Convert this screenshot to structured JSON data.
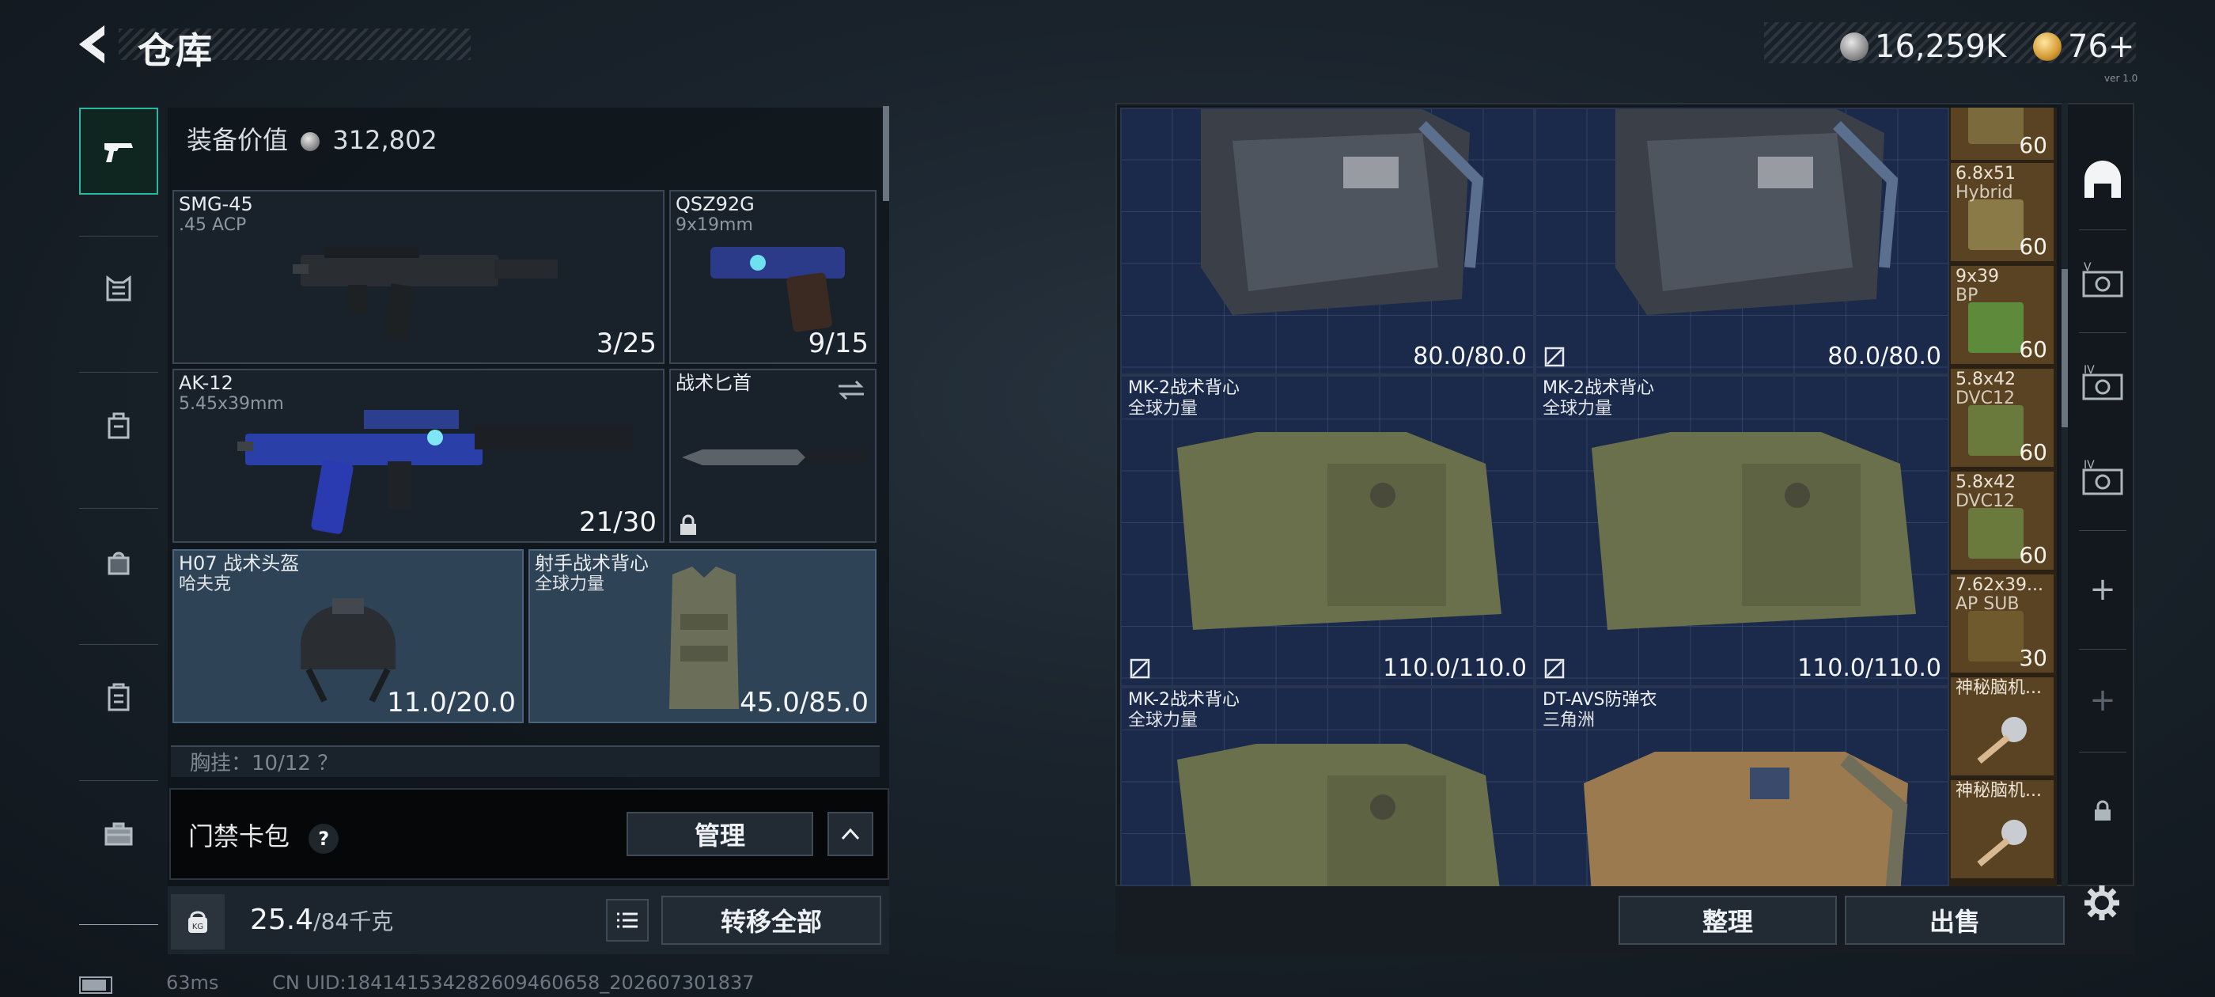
{
  "header": {
    "title": "仓库",
    "currency": [
      {
        "icon": "silver-coin-icon",
        "value": "16,259K"
      },
      {
        "icon": "gold-coin-icon",
        "value": "76+"
      }
    ],
    "tiny_text": "ver 1.0"
  },
  "left_rail": [
    "pistol-icon",
    "armor-rig-icon",
    "backpack-icon",
    "bag-icon",
    "case-icon",
    "toolbox-icon"
  ],
  "loadout": {
    "value_label": "装备价值",
    "value": "312,802",
    "slots": [
      {
        "name": "SMG-45",
        "sub": ".45 ACP",
        "count": "3/25"
      },
      {
        "name": "QSZ92G",
        "sub": "9x19mm",
        "count": "9/15"
      },
      {
        "name": "AK-12",
        "sub": "5.45x39mm",
        "count": "21/30"
      },
      {
        "name": "战术匕首",
        "sub": "",
        "count": ""
      },
      {
        "name": "H07 战术头盔",
        "sub": "哈夫克",
        "count": "11.0/20.0"
      },
      {
        "name": "射手战术背心",
        "sub": "全球力量",
        "count": "45.0/85.0"
      }
    ],
    "chest_row": "胸挂：10/12 ？",
    "keycard_label": "门禁卡包",
    "help": "?",
    "manage_button": "管理",
    "weight": "25.4",
    "weight_max": "/84千克",
    "transfer_button": "转移全部",
    "kg_label": "KG"
  },
  "status": {
    "ping": "63ms",
    "uid": "CN UID:1841415342826094606​58_202607301837"
  },
  "inventory": {
    "items": [
      {
        "name": "",
        "sub": "",
        "durability": ""
      },
      {
        "name": "",
        "sub": "",
        "durability": "80.0/80.0"
      },
      {
        "name": "",
        "sub": "",
        "durability": "80.0/80.0"
      },
      {
        "name": "MK-2战术背心",
        "sub": "全球力量",
        "durability": "110.0/110.0"
      },
      {
        "name": "MK-2战术背心",
        "sub": "全球力量",
        "durability": "110.0/110.0"
      },
      {
        "name": "MK-2战术背心",
        "sub": "全球力量",
        "durability": ""
      },
      {
        "name": "DT-AVS防弹衣",
        "sub": "三角洲",
        "durability": ""
      }
    ],
    "ammo": [
      {
        "name": "",
        "sub": "",
        "count": "60"
      },
      {
        "name": "6.8x51",
        "sub": "Hybrid",
        "count": "60"
      },
      {
        "name": "9x39",
        "sub": "BP",
        "count": "60"
      },
      {
        "name": "5.8x42",
        "sub": "DVC12",
        "count": "60"
      },
      {
        "name": "5.8x42",
        "sub": "DVC12",
        "count": "60"
      },
      {
        "name": "7.62x39...",
        "sub": "AP SUB",
        "count": "30"
      },
      {
        "name": "神秘脑机...",
        "sub": "",
        "count": ""
      },
      {
        "name": "神秘脑机...",
        "sub": "",
        "count": ""
      }
    ],
    "sort_button": "整理",
    "sell_button": "出售",
    "right_rail": [
      "shop-arch-icon",
      "case-v-icon",
      "case-iv-icon",
      "case-iv-b-icon",
      "plus",
      "plus",
      "lock-icon",
      "gear-icon"
    ],
    "right_rail_text": [
      "",
      "V",
      "IV",
      "IV",
      "+",
      "+",
      "",
      ""
    ]
  }
}
